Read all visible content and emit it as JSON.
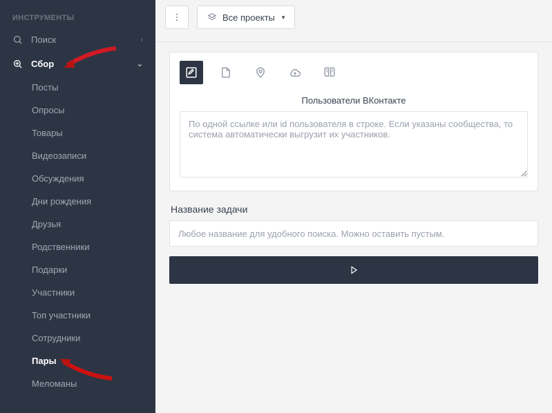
{
  "sidebar": {
    "header": "ИНСТРУМЕНТЫ",
    "search_label": "Поиск",
    "collect_label": "Сбор",
    "items": [
      "Посты",
      "Опросы",
      "Товары",
      "Видеозаписи",
      "Обсуждения",
      "Дни рождения",
      "Друзья",
      "Родственники",
      "Подарки",
      "Участники",
      "Топ участники",
      "Сотрудники",
      "Пары",
      "Меломаны"
    ],
    "active_sub": "Пары"
  },
  "topbar": {
    "projects_label": "Все проекты"
  },
  "form": {
    "section_label": "Пользователи ВКонтакте",
    "textarea_placeholder": "По одной ссылке или id пользователя в строке. Если указаны сообщества, то система автоматически выгрузит их участников.",
    "task_name_label": "Название задачи",
    "task_name_placeholder": "Любое название для удобного поиска. Можно оставить пустым."
  }
}
